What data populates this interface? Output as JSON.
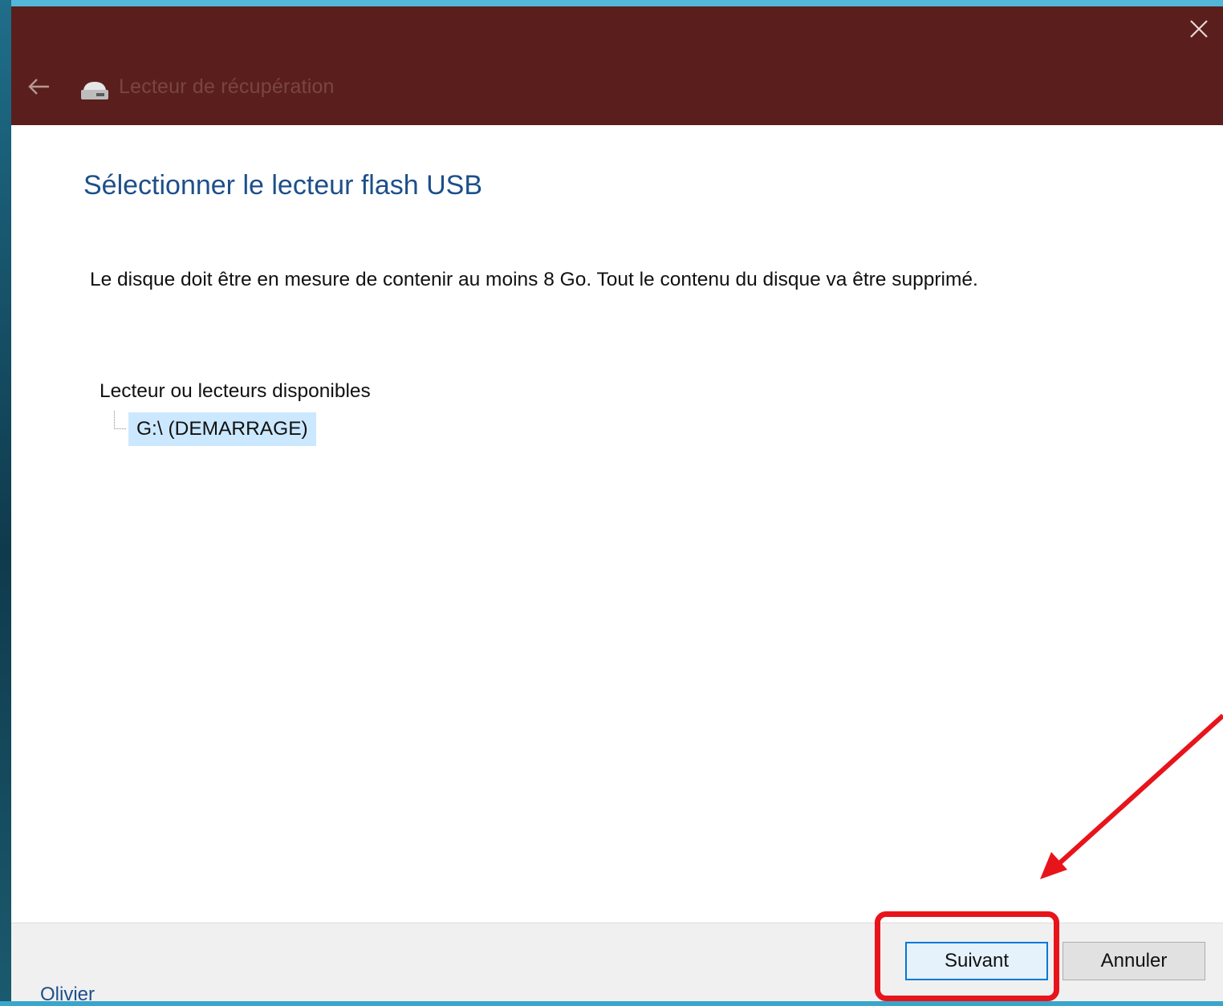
{
  "window": {
    "title": "Lecteur de récupération",
    "close_icon": "close-icon",
    "back_icon": "back-arrow-icon",
    "app_icon": "usb-drive-icon"
  },
  "content": {
    "heading": "Sélectionner le lecteur flash USB",
    "description": "Le disque doit être en mesure de contenir au moins 8 Go. Tout le contenu du disque va être supprimé.",
    "tree_label": "Lecteur ou lecteurs disponibles",
    "drives": [
      "G:\\ (DEMARRAGE)"
    ],
    "selected_drive": "G:\\ (DEMARRAGE)"
  },
  "footer": {
    "next_label": "Suivant",
    "cancel_label": "Annuler"
  },
  "annotation": {
    "highlight_color": "#e8141b",
    "credit": "Olivier"
  },
  "colors": {
    "titlebar": "#5a1f1c",
    "heading": "#1d4f8a",
    "selection": "#cce8ff"
  }
}
